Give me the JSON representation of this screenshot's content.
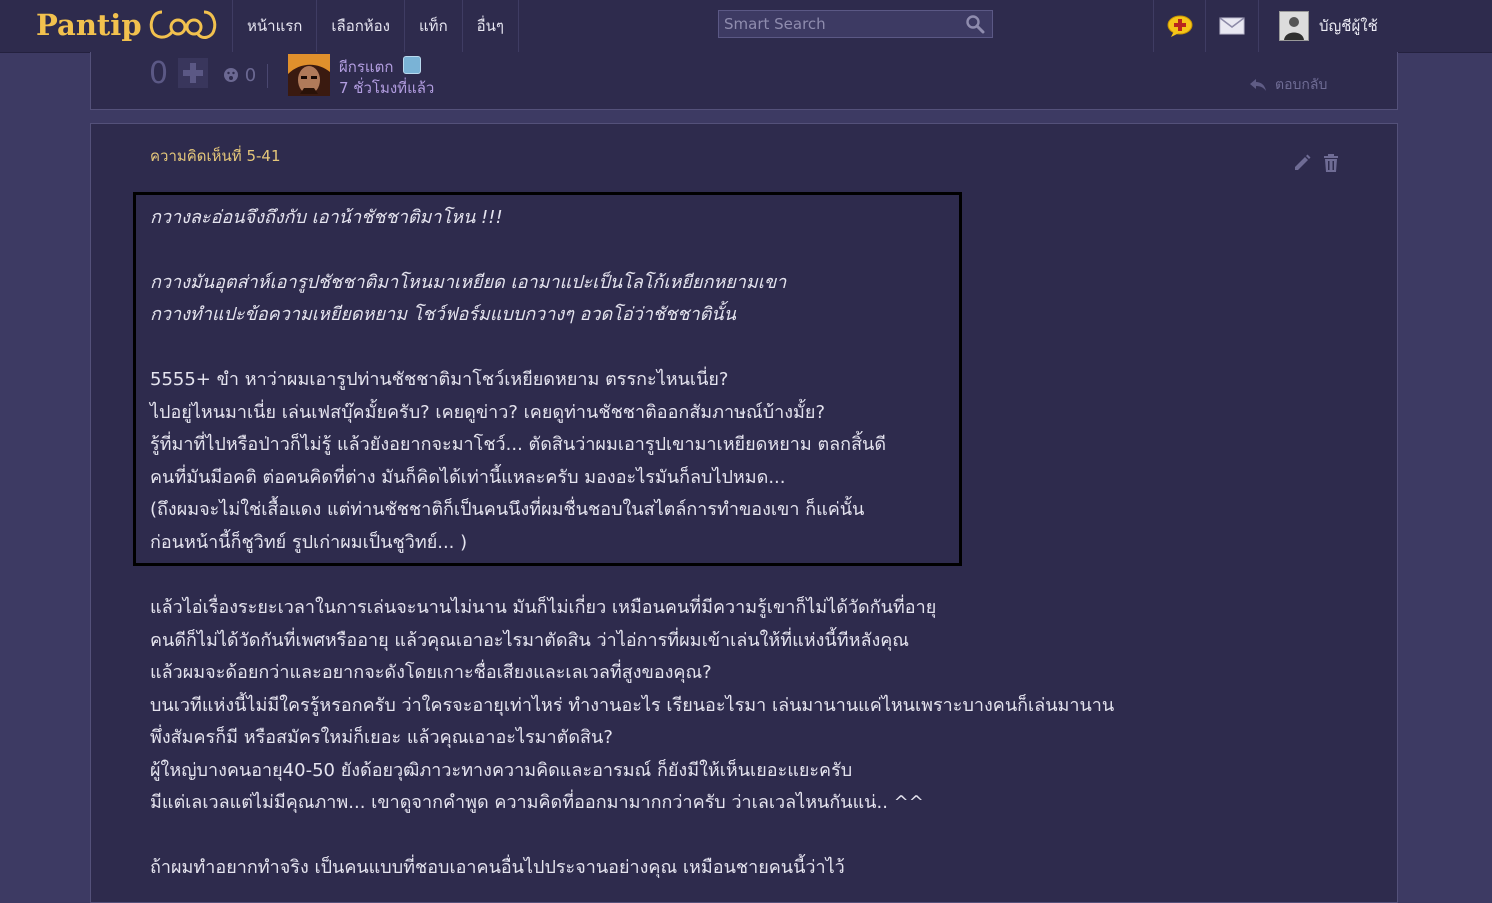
{
  "logo": {
    "text": "Pantip"
  },
  "nav": [
    {
      "label": "หน้าแรก"
    },
    {
      "label": "เลือกห้อง"
    },
    {
      "label": "แท็ก"
    },
    {
      "label": "อื่นๆ"
    }
  ],
  "search": {
    "placeholder": "Smart Search"
  },
  "header_icons": [
    "new-topic-icon",
    "mail-icon"
  ],
  "account": {
    "label": "บัญชีผู้ใช้"
  },
  "prev_comment": {
    "votes": "0",
    "emotions": "0",
    "author": "ผีกรแตก",
    "time": "7 ชั่วโมงที่แล้ว",
    "reply_label": "ตอบกลับ"
  },
  "comment": {
    "number": "ความคิดเห็นที่ 5-41",
    "quote_lines": [
      "กวางละอ่อนจึงถึงกับ เอาน้าชัชชาติมาโหน !!!",
      "กวางมันอุตส่าห์เอารูปชัชชาติมาโหนมาเหยียด เอามาแปะเป็นโลโก้เหยียกหยามเขา",
      "กวางทำแปะข้อความเหยียดหยาม โชว์ฟอร์มแบบกวางๆ อวดโอ่ว่าชัชชาตินั้น",
      "5555+ ขำ หาว่าผมเอารูปท่านชัชชาติมาโชว์เหยียดหยาม ตรรกะไหนเนี่ย?",
      "ไปอยู่ไหนมาเนี่ย เล่นเฟสบุ๊คมั้ยครับ? เคยดูข่าว? เคยดูท่านชัชชาติออกสัมภาษณ์บ้างมั้ย?",
      "รู้ที่มาที่ไปหรือป่าวก็ไม่รู้ แล้วยังอยากจะมาโชว์... ตัดสินว่าผมเอารูปเขามาเหยียดหยาม ตลกสิ้นดี",
      "คนที่มันมีอคติ ต่อคนคิดที่ต่าง มันก็คิดได้เท่านี้แหละครับ มองอะไรมันก็ลบไปหมด...",
      "(ถึงผมจะไม่ใช่เสื้อแดง แต่ท่านชัชชาติก็เป็นคนนึงที่ผมชื่นชอบในสไตล์การทำของเขา ก็แค่นั้น",
      "ก่อนหน้านี้ก็ชูวิทย์ รูปเก่าผมเป็นชูวิทย์... )"
    ],
    "body_lines": [
      "แล้วไอ่เรื่องระยะเวลาในการเล่นจะนานไม่นาน มันก็ไม่เกี่ยว เหมือนคนที่มีความรู้เขาก็ไม่ได้วัดกันที่อายุ",
      "คนดีก็ไม่ได้วัดกันที่เพศหรืออายุ แล้วคุณเอาอะไรมาตัดสิน ว่าไอ่การที่ผมเข้าเล่นให้ที่แห่งนี้ทีหลังคุณ",
      "แล้วผมจะด้อยกว่าและอยากจะดังโดยเกาะชื่อเสียงและเลเวลที่สูงของคุณ?",
      "บนเวทีแห่งนี้ไม่มีใครรู้หรอกครับ ว่าใครจะอายุเท่าไหร่ ทำงานอะไร เรียนอะไรมา เล่นมานานแค่ไหนเพราะบางคนก็เล่นมานาน",
      "พึ่งสัมครก็มี หรือสมัครใหม่ก็เยอะ แล้วคุณเอาอะไรมาตัดสิน?",
      "ผู้ใหญ่บางคนอายุ40-50 ยังด้อยวุฒิภาวะทางความคิดและอารมณ์ ก็ยังมีให้เห็นเยอะแยะครับ",
      "มีแต่เลเวลแต่ไม่มีคุณภาพ... เขาดูจากคำพูด ความคิดที่ออกมามากกว่าครับ ว่าเลเวลไหนกันแน่.. ^^",
      "ถ้าผมทำอยากทำจริง เป็นคนแบบที่ชอบเอาคนอื่นไปประจานอย่างคุณ เหมือนชายคนนี้ว่าไว้"
    ]
  },
  "colors": {
    "background": "#3d3a63",
    "card": "#2e2b4d",
    "logo": "#f2c14e",
    "comment_number": "#e5c77a",
    "author": "#b29de0"
  }
}
